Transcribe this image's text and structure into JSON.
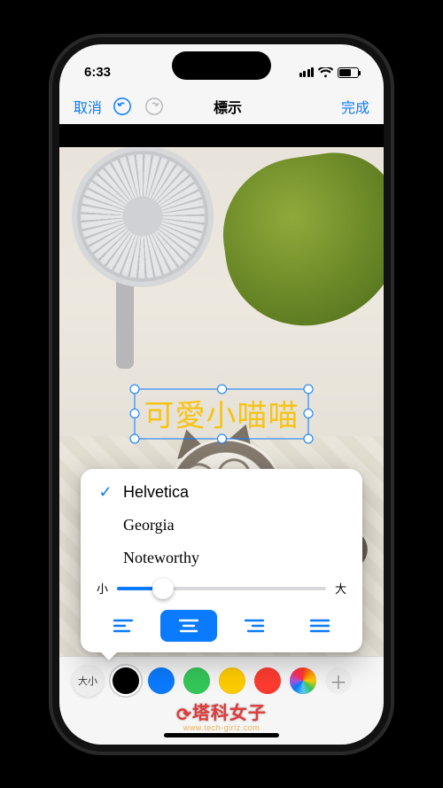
{
  "status": {
    "time": "6:33"
  },
  "nav": {
    "cancel": "取消",
    "title": "標示",
    "done": "完成"
  },
  "annotation": {
    "text": "可愛小喵喵"
  },
  "font_picker": {
    "fonts": [
      {
        "name": "Helvetica",
        "selected": true
      },
      {
        "name": "Georgia",
        "selected": false
      },
      {
        "name": "Noteworthy",
        "selected": false
      }
    ],
    "size": {
      "min_label": "小",
      "max_label": "大",
      "value_pct": 22
    },
    "alignment": {
      "options": [
        "left",
        "center",
        "right",
        "justify"
      ],
      "selected": "center"
    }
  },
  "colorbar": {
    "text_style_button": "大小",
    "colors": [
      "black",
      "blue",
      "green",
      "yellow",
      "red"
    ],
    "selected_color": "black"
  },
  "watermark": {
    "brand": "塔科女子",
    "url": "www.tech-girlz.com"
  }
}
